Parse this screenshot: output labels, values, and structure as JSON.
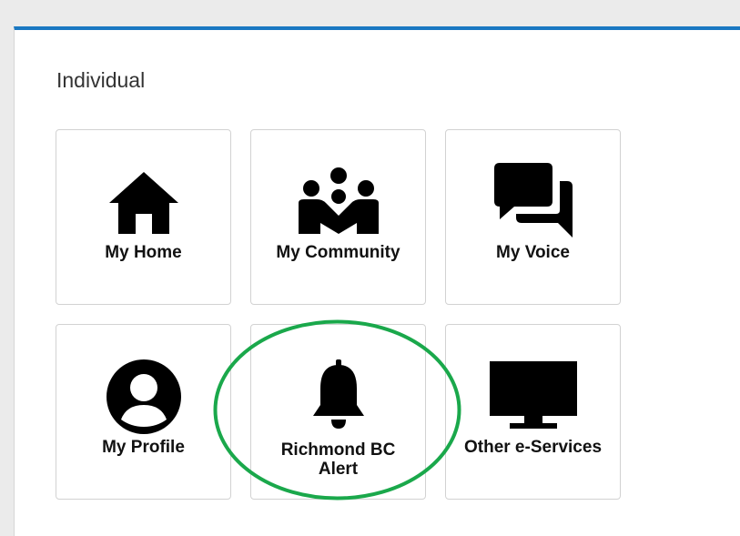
{
  "section": {
    "title": "Individual"
  },
  "tiles": [
    {
      "label": "My Home",
      "icon": "home-icon"
    },
    {
      "label": "My Community",
      "icon": "community-icon"
    },
    {
      "label": "My Voice",
      "icon": "chat-bubbles-icon"
    },
    {
      "label": "My Profile",
      "icon": "user-circle-icon"
    },
    {
      "label": "Richmond BC Alert",
      "icon": "bell-icon"
    },
    {
      "label": "Other e-Services",
      "icon": "monitor-icon"
    }
  ],
  "highlight": {
    "color": "#1aa84b",
    "target": "Richmond BC Alert"
  },
  "colors": {
    "accent": "#1a78c2",
    "icon": "#000000"
  }
}
